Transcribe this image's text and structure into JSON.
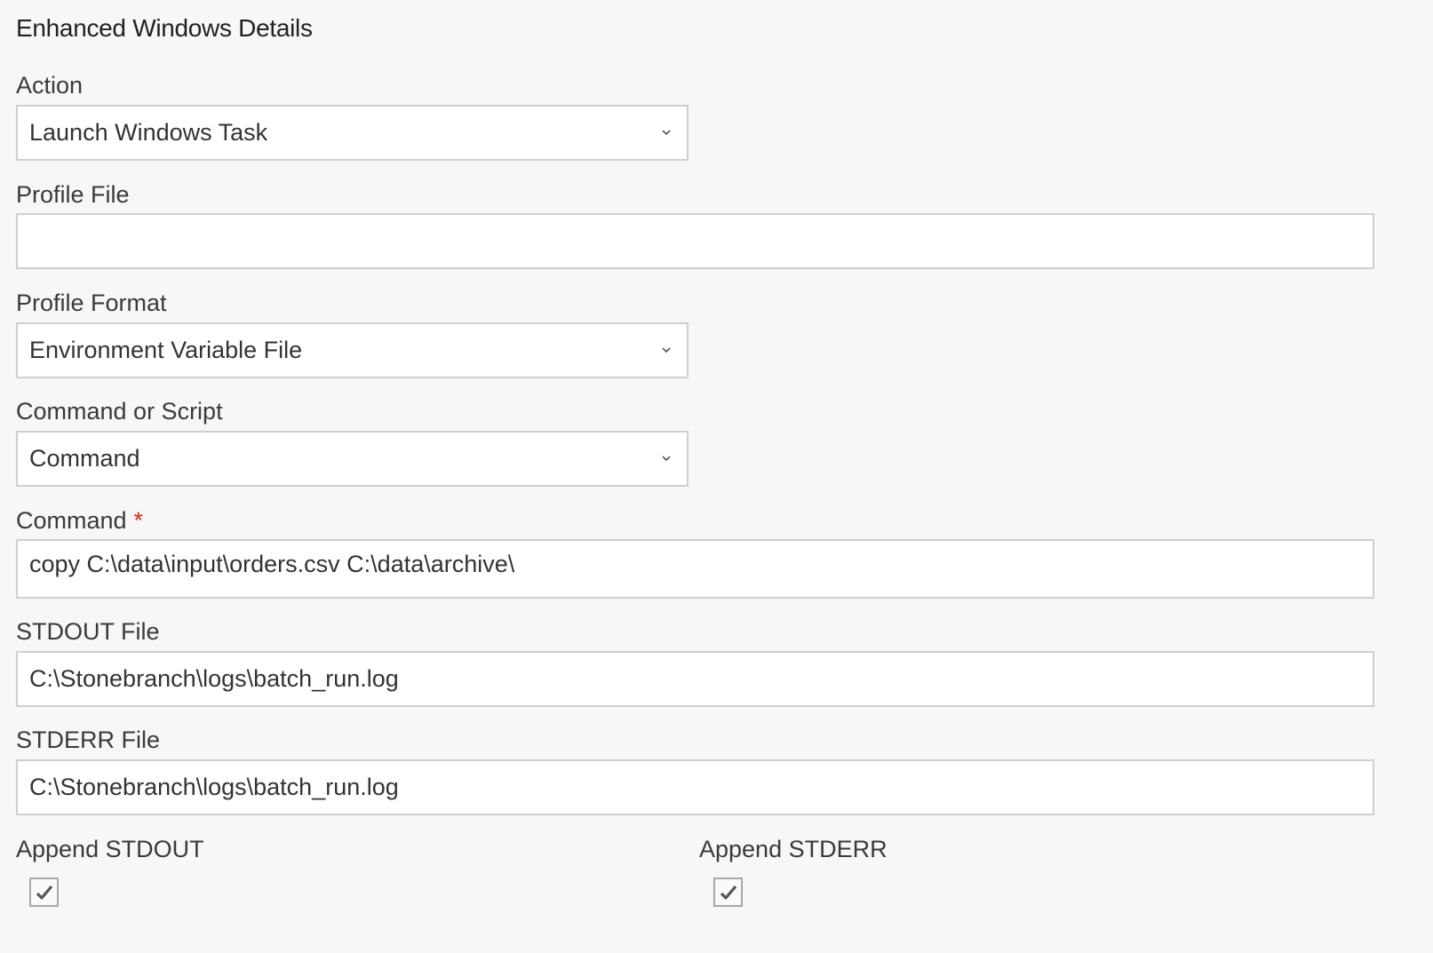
{
  "section_title": "Enhanced Windows Details",
  "action": {
    "label": "Action",
    "value": "Launch Windows Task"
  },
  "profile_file": {
    "label": "Profile File",
    "value": ""
  },
  "profile_format": {
    "label": "Profile Format",
    "value": "Environment Variable File"
  },
  "command_or_script": {
    "label": "Command or Script",
    "value": "Command"
  },
  "command": {
    "label": "Command",
    "required_marker": "*",
    "value": "copy C:\\data\\input\\orders.csv C:\\data\\archive\\"
  },
  "stdout_file": {
    "label": "STDOUT File",
    "value": "C:\\Stonebranch\\logs\\batch_run.log"
  },
  "stderr_file": {
    "label": "STDERR File",
    "value": "C:\\Stonebranch\\logs\\batch_run.log"
  },
  "append_stdout": {
    "label": "Append STDOUT",
    "checked": true
  },
  "append_stderr": {
    "label": "Append STDERR",
    "checked": true
  },
  "icons": {
    "dropdown": "chevron-down-icon",
    "check": "checkmark-icon"
  },
  "colors": {
    "required": "#d9251d",
    "border": "#cfcfcf",
    "background": "#f7f7f7"
  }
}
